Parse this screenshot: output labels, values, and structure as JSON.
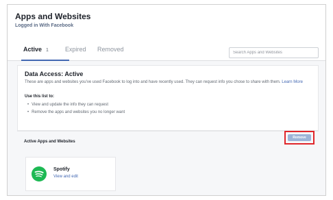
{
  "header": {
    "title": "Apps and Websites",
    "subtitle": "Logged in With Facebook"
  },
  "tabs": [
    {
      "label": "Active",
      "count": "1"
    },
    {
      "label": "Expired"
    },
    {
      "label": "Removed"
    }
  ],
  "search": {
    "placeholder": "Search Apps and Websites"
  },
  "data_access": {
    "title": "Data Access: Active",
    "description": "These are apps and websites you've used Facebook to log into and have recently used. They can request info you chose to share with them.",
    "learn_more": "Learn More",
    "use_title": "Use this list to:",
    "bullets": [
      "View and update the info they can request",
      "Remove the apps and websites you no longer want"
    ]
  },
  "active_section": {
    "label": "Active Apps and Websites",
    "remove_button": "Remove"
  },
  "app": {
    "name": "Spotify",
    "link": "View and edit"
  },
  "colors": {
    "accent": "#4267b2",
    "spotify": "#1db954",
    "highlight": "#e0252a"
  }
}
